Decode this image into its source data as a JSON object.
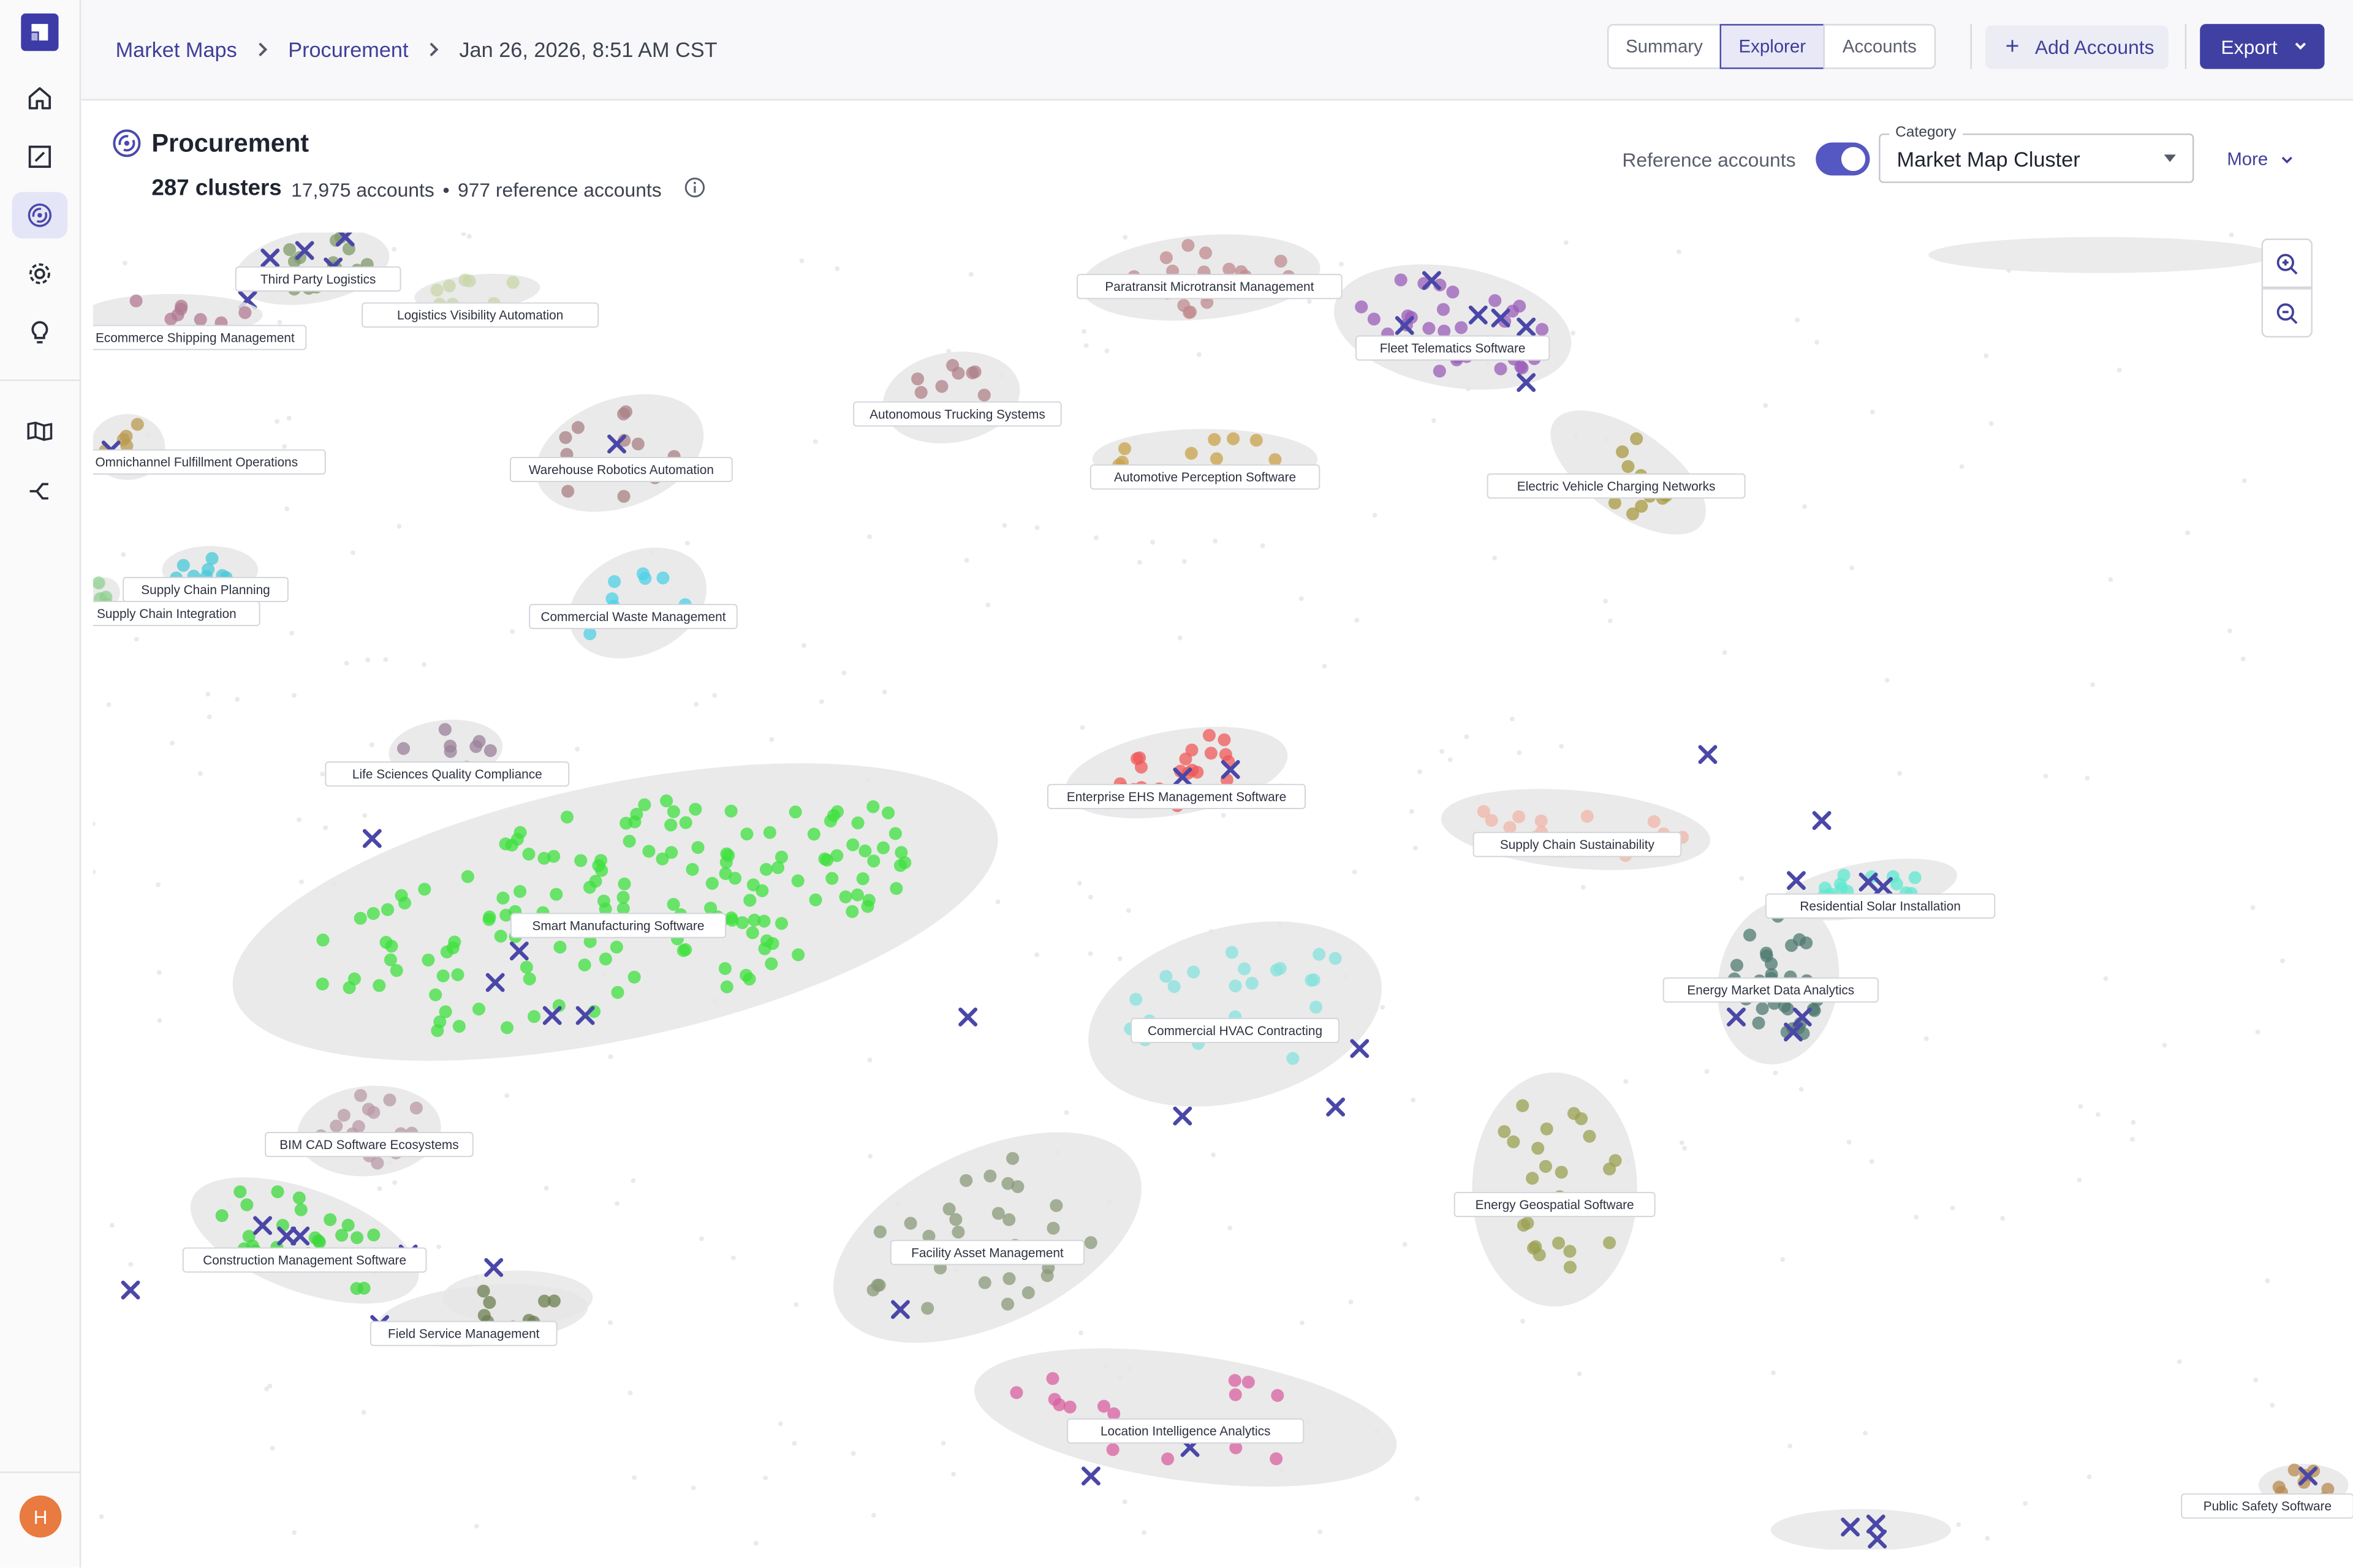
{
  "breadcrumb": {
    "root": "Market Maps",
    "section": "Procurement",
    "timestamp": "Jan 26, 2026, 8:51 AM CST"
  },
  "view_tabs": [
    {
      "label": "Summary",
      "active": false
    },
    {
      "label": "Explorer",
      "active": true
    },
    {
      "label": "Accounts",
      "active": false
    }
  ],
  "actions": {
    "add_accounts": "Add Accounts",
    "export": "Export"
  },
  "header": {
    "title": "Procurement",
    "clusters": "287 clusters",
    "accounts": "17,975 accounts",
    "bullet": "•",
    "reference": "977 reference accounts"
  },
  "controls": {
    "reference_label": "Reference accounts",
    "reference_on": true,
    "category_label": "Category",
    "category_value": "Market Map Cluster",
    "more": "More"
  },
  "user": {
    "initial": "H"
  },
  "colors": {
    "accent": "#4040a3",
    "marker": "#4a47a8",
    "hull": "#e6e6e6"
  },
  "clusters": [
    {
      "label": "Third Party Logistics",
      "color": "#7f9a6a"
    },
    {
      "label": "Logistics Visibility Automation",
      "color": "#c8d6a8"
    },
    {
      "label": "Ecommerce Shipping Management",
      "color": "#b27a92"
    },
    {
      "label": "Omnichannel Fulfillment Operations",
      "color": "#b99a50"
    },
    {
      "label": "Supply Chain Planning",
      "color": "#48c8d8"
    },
    {
      "label": "Supply Chain Integration",
      "color": "#8fcf8f"
    },
    {
      "label": "Warehouse Robotics Automation",
      "color": "#a88084"
    },
    {
      "label": "Autonomous Trucking Systems",
      "color": "#b0808a"
    },
    {
      "label": "Commercial Waste Management",
      "color": "#4fd0e6"
    },
    {
      "label": "Paratransit Microtransit Management",
      "color": "#c08a8e"
    },
    {
      "label": "Fleet Telematics Software",
      "color": "#9a5cb8"
    },
    {
      "label": "Automotive Perception Software",
      "color": "#c9a24a"
    },
    {
      "label": "Electric Vehicle Charging Networks",
      "color": "#a89a40"
    },
    {
      "label": "Life Sciences Quality Compliance",
      "color": "#9a809a"
    },
    {
      "label": "Smart Manufacturing Software",
      "color": "#3ee03e"
    },
    {
      "label": "Enterprise EHS Management Software",
      "color": "#ef5a5a"
    },
    {
      "label": "Supply Chain Sustainability",
      "color": "#f0b6a8"
    },
    {
      "label": "Residential Solar Installation",
      "color": "#5fe8d0"
    },
    {
      "label": "Energy Market Data Analytics",
      "color": "#4f7a70"
    },
    {
      "label": "Commercial HVAC Contracting",
      "color": "#86e2dc"
    },
    {
      "label": "BIM CAD Software Ecosystems",
      "color": "#b89aa6"
    },
    {
      "label": "Construction Management Software",
      "color": "#3cd83c"
    },
    {
      "label": "Field Service Management",
      "color": "#6d7f52"
    },
    {
      "label": "Facility Asset Management",
      "color": "#8a9a78"
    },
    {
      "label": "Energy Geospatial Software",
      "color": "#9aa050"
    },
    {
      "label": "Location Intelligence Analytics",
      "color": "#d860a0"
    },
    {
      "label": "Public Safety Software",
      "color": "#b88a50"
    }
  ]
}
